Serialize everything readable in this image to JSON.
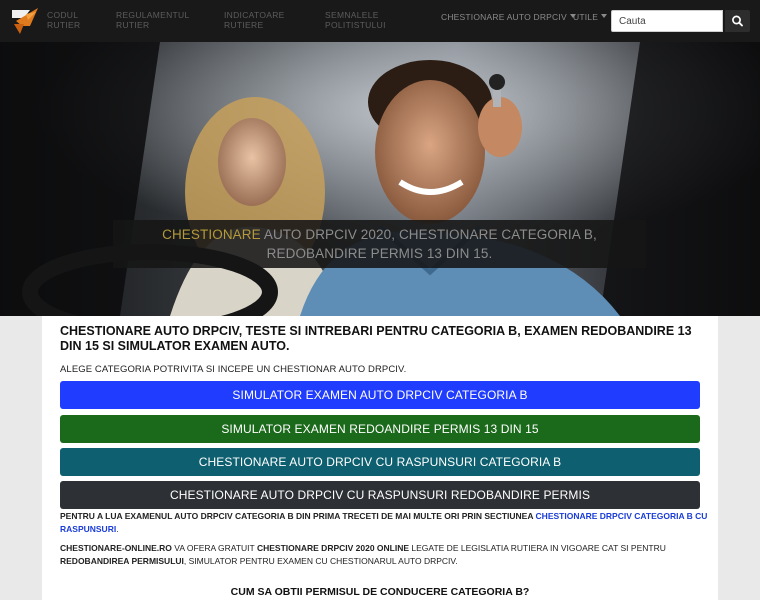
{
  "nav": {
    "items": [
      {
        "line1": "CODUL",
        "line2": "RUTIER"
      },
      {
        "line1": "REGULAMENTUL",
        "line2": "RUTIER"
      },
      {
        "line1": "INDICATOARE",
        "line2": "RUTIERE"
      },
      {
        "line1": "SEMNALELE",
        "line2": "POLITISTULUI"
      }
    ],
    "dropdown_chestionare": "CHESTIONARE AUTO DRPCIV",
    "dropdown_utile": "UTILE",
    "search_placeholder": "Cauta"
  },
  "hero": {
    "caption_highlight": "CHESTIONARE",
    "caption_rest": " AUTO DRPCIV 2020, CHESTIONARE CATEGORIA B, REDOBANDIRE PERMIS 13 DIN 15."
  },
  "main": {
    "title": "CHESTIONARE AUTO DRPCIV, TESTE SI INTREBARI PENTRU CATEGORIA B, EXAMEN REDOBANDIRE 13 DIN 15 SI SIMULATOR EXAMEN AUTO.",
    "lead": "ALEGE CATEGORIA POTRIVITA SI INCEPE UN CHESTIONAR AUTO DRPCIV.",
    "buttons": [
      {
        "label": "SIMULATOR EXAMEN AUTO DRPCIV CATEGORIA B",
        "color": "#1f3cff"
      },
      {
        "label": "SIMULATOR EXAMEN REDOANDIRE PERMIS 13 DIN 15",
        "color": "#1b6a1b"
      },
      {
        "label": "CHESTIONARE AUTO DRPCIV CU RASPUNSURI CATEGORIA B",
        "color": "#0e5f6f"
      },
      {
        "label": "CHESTIONARE AUTO DRPCIV CU RASPUNSURI REDOBANDIRE PERMIS",
        "color": "#2d3035"
      }
    ],
    "p1_text": "PENTRU A LUA EXAMENUL AUTO DRPCIV CATEGORIA B DIN PRIMA TRECETI DE MAI MULTE ORI PRIN SECTIUNEA ",
    "p1_link": "CHESTIONARE DRPCIV CATEGORIA B CU RASPUNSURI",
    "p1_end": ".",
    "p2_site": "CHESTIONARE-ONLINE.RO",
    "p2_t1": " VA OFERA GRATUIT ",
    "p2_b1": "CHESTIONARE DRPCIV 2020 ONLINE",
    "p2_t2": " LEGATE DE LEGISLATIA RUTIERA IN VIGOARE CAT SI PENTRU ",
    "p2_b2": "REDOBANDIREA PERMISULUI",
    "p2_t3": ", SIMULATOR PENTRU EXAMEN CU CHESTIONARUL AUTO DRPCIV.",
    "subtitle": "CUM SA OBTII PERMISUL DE CONDUCERE CATEGORIA B?"
  },
  "icons": {
    "logo": "site-logo-icon",
    "search": "search-icon",
    "caret": "caret-down-icon"
  },
  "colors": {
    "navbar": "#191919",
    "link": "#1a3cd8",
    "caption_highlight": "#b49a3a"
  }
}
